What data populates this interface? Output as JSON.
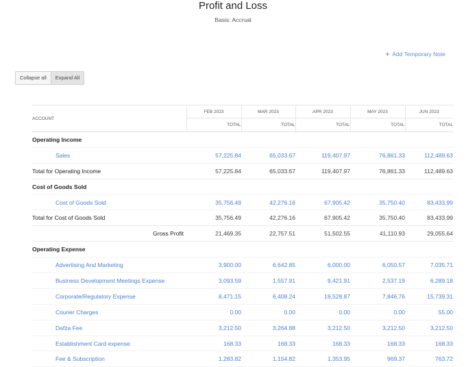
{
  "header": {
    "title": "Profit and Loss",
    "basis": "Basis: Accrual",
    "add_note": "Add Temporary Note"
  },
  "toolbar": {
    "collapse_all": "Collapse all",
    "expand_all": "Expand All"
  },
  "table": {
    "account_header": "ACCOUNT",
    "periods": [
      "FEB 2023",
      "MAR 2023",
      "APR 2023",
      "MAY 2023",
      "JUN 2023"
    ],
    "sub_header": "TOTAL",
    "rows": [
      {
        "type": "section",
        "label": "Operating Income",
        "values": [
          "",
          "",
          "",
          "",
          ""
        ]
      },
      {
        "type": "item",
        "label": "Sales",
        "values": [
          "57,225.84",
          "65,033.67",
          "119,407.97",
          "76,861.33",
          "112,489.63"
        ]
      },
      {
        "type": "total",
        "label": "Total for Operating Income",
        "values": [
          "57,225.84",
          "65,033.67",
          "119,407.97",
          "76,861.33",
          "112,489.63"
        ]
      },
      {
        "type": "section",
        "label": "Cost of Goods Sold",
        "values": [
          "",
          "",
          "",
          "",
          ""
        ]
      },
      {
        "type": "item",
        "label": "Cost of Goods Sold",
        "values": [
          "35,756.49",
          "42,276.16",
          "67,905.42",
          "35,750.40",
          "83,433.99"
        ]
      },
      {
        "type": "total",
        "label": "Total for Cost of Goods Sold",
        "values": [
          "35,756.49",
          "42,276.16",
          "67,905.42",
          "35,750.40",
          "83,433.99"
        ]
      },
      {
        "type": "gp",
        "label": "Gross Profit",
        "values": [
          "21,469.35",
          "22,757.51",
          "51,502.55",
          "41,110.93",
          "29,055.64"
        ]
      },
      {
        "type": "section",
        "label": "Operating Expense",
        "values": [
          "",
          "",
          "",
          "",
          ""
        ]
      },
      {
        "type": "item",
        "label": "Advertising And Marketing",
        "values": [
          "3,900.00",
          "6,642.85",
          "6,000.00",
          "6,050.57",
          "7,035.71"
        ]
      },
      {
        "type": "item",
        "label": "Business Development Meetings Expense",
        "values": [
          "3,093.59",
          "1,557.91",
          "9,421.91",
          "2,537.19",
          "6,289.18"
        ]
      },
      {
        "type": "item",
        "label": "Corporate/Regulatory Expense",
        "values": [
          "8,471.15",
          "6,408.24",
          "19,528.87",
          "7,846.76",
          "15,739.31"
        ]
      },
      {
        "type": "item",
        "label": "Courier Charges",
        "values": [
          "0.00",
          "0.00",
          "0.00",
          "0.00",
          "55.00"
        ]
      },
      {
        "type": "item",
        "label": "Dafza Fee",
        "values": [
          "3,212.50",
          "3,264.88",
          "3,212.50",
          "3,212.50",
          "3,212.50"
        ]
      },
      {
        "type": "item",
        "label": "Establishment Card expense",
        "values": [
          "168.33",
          "168.33",
          "168.33",
          "168.33",
          "168.33"
        ]
      },
      {
        "type": "item",
        "label": "Fee & Subscription",
        "values": [
          "1,283.82",
          "1,154.82",
          "1,353.95",
          "969.37",
          "763.72"
        ]
      }
    ]
  }
}
